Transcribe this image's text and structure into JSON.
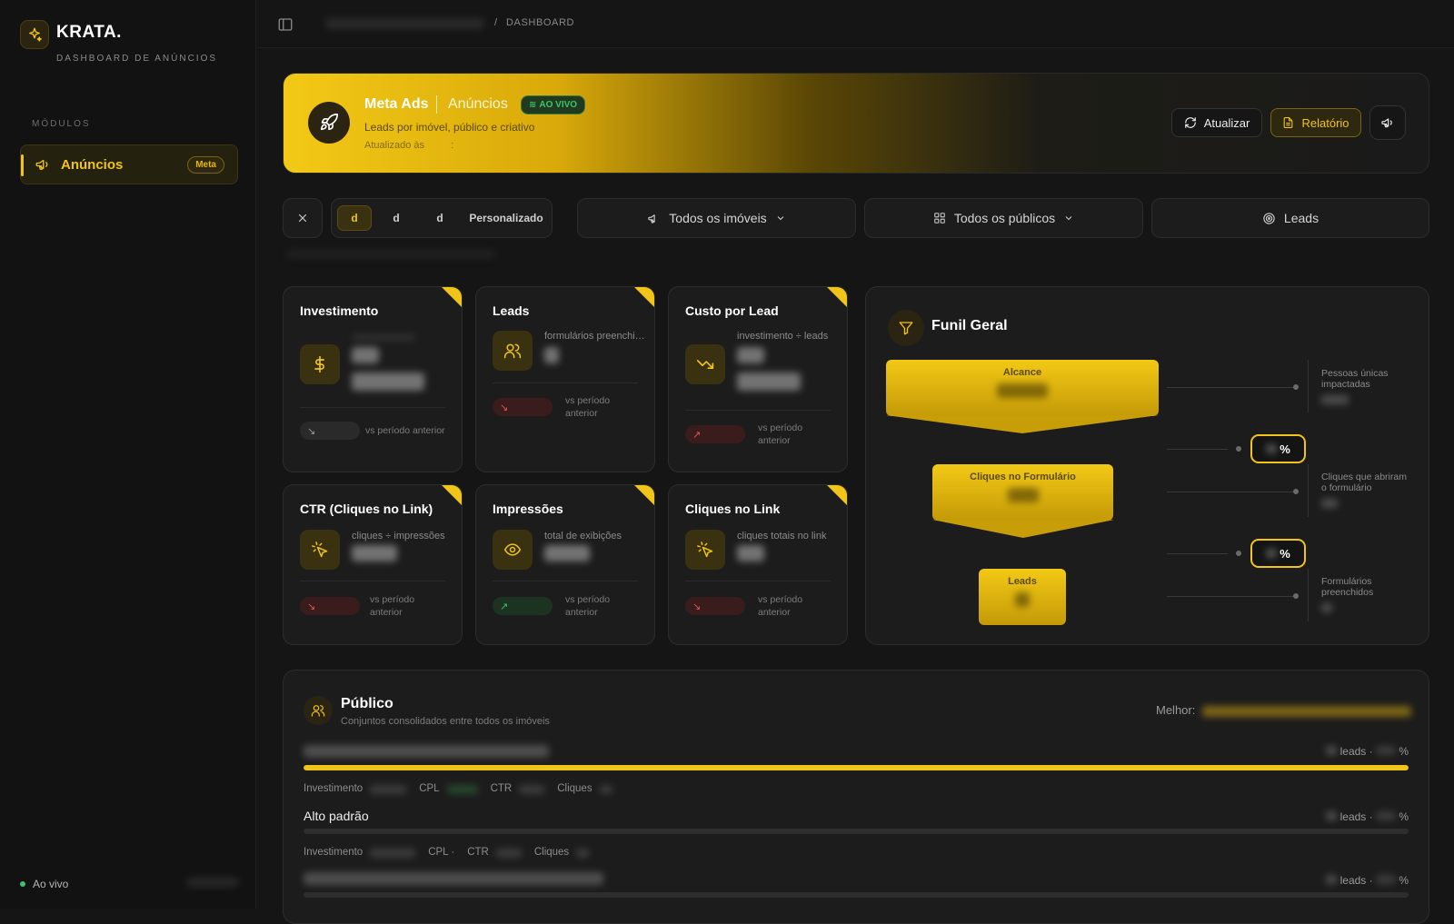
{
  "brand": {
    "name": "KRATA.",
    "subtitle": "DASHBOARD DE ANÚNCIOS"
  },
  "sidebar": {
    "section_label": "MÓDULOS",
    "items": [
      {
        "label": "Anúncios",
        "badge": "Meta",
        "active": true
      }
    ],
    "status": "Ao vivo"
  },
  "topbar": {
    "breadcrumb_current": "DASHBOARD",
    "breadcrumb_separator": "/"
  },
  "hero": {
    "title": "Meta Ads",
    "section": "Anúncios",
    "live_badge": "AO VIVO",
    "description": "Leads por imóvel, público e criativo",
    "updated_label": "Atualizado às",
    "updated_sep": ":",
    "buttons": {
      "refresh": "Atualizar",
      "report": "Relatório"
    }
  },
  "filters": {
    "periods": [
      "d",
      "d",
      "d",
      "Personalizado"
    ],
    "active_period": 0,
    "property_select": "Todos os imóveis",
    "audience_select": "Todos os públicos",
    "metric_select": "Leads"
  },
  "kpis": [
    {
      "title": "Investimento",
      "subtitle": "",
      "vs_label": "vs período anterior"
    },
    {
      "title": "Leads",
      "subtitle": "formulários preenchidos",
      "vs_label": "vs período anterior"
    },
    {
      "title": "Custo por Lead",
      "subtitle": "investimento ÷ leads",
      "vs_label": "vs período anterior"
    },
    {
      "title": "CTR (Cliques no Link)",
      "subtitle": "cliques ÷ impressões",
      "vs_label": "vs período anterior"
    },
    {
      "title": "Impressões",
      "subtitle": "total de exibições",
      "vs_label": "vs período anterior"
    },
    {
      "title": "Cliques no Link",
      "subtitle": "cliques totais no link",
      "vs_label": "vs período anterior"
    }
  ],
  "funnel": {
    "title": "Funil Geral",
    "stages": [
      {
        "label": "Alcance",
        "side_label": "Pessoas únicas impactadas"
      },
      {
        "label": "Cliques no Formulário",
        "side_label": "Cliques que abriram o formulário"
      },
      {
        "label": "Leads",
        "side_label": "Formulários preenchidos"
      }
    ],
    "percent_symbol": "%"
  },
  "public": {
    "title": "Público",
    "subtitle": "Conjuntos consolidados entre todos os imóveis",
    "best_label": "Melhor:",
    "rows": [
      {
        "name": "",
        "bar_fill": 1.0,
        "leads_label": "leads ·",
        "pct_label": "%",
        "metrics": {
          "inv": "Investimento",
          "cpl": "CPL",
          "ctr": "CTR",
          "clk": "Cliques"
        }
      },
      {
        "name": "Alto padrão",
        "bar_fill": 0.0,
        "leads_label": "leads ·",
        "pct_label": "%",
        "metrics": {
          "inv": "Investimento",
          "cpl": "CPL ·",
          "ctr": "CTR",
          "clk": "Cliques"
        }
      },
      {
        "name": "",
        "bar_fill": 0.0,
        "leads_label": "leads ·",
        "pct_label": "%"
      }
    ]
  },
  "colors": {
    "accent": "#f0c419",
    "background": "#151515",
    "card": "#1c1c1c",
    "live_green": "#3fc26a",
    "trend_down": "#e05555",
    "trend_up": "#3fc26a"
  }
}
